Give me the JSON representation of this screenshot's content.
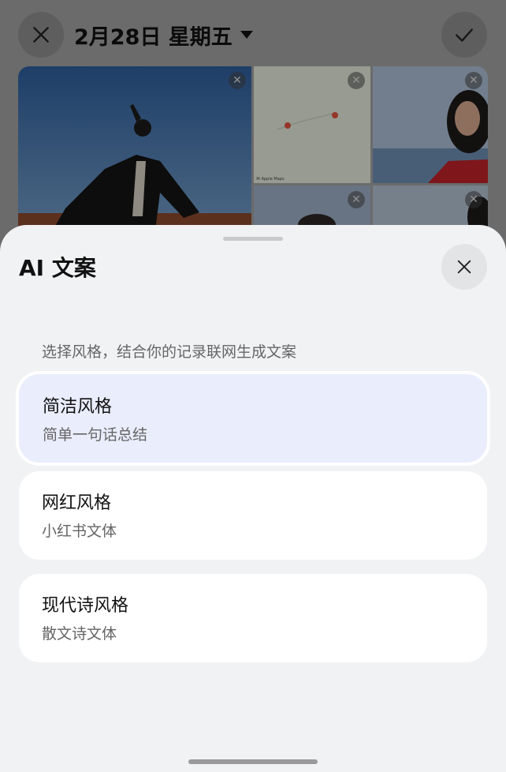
{
  "header": {
    "date": "2月28日 星期五"
  },
  "photos": {
    "map_caption": "⌘ Apple Maps"
  },
  "sheet": {
    "title": "AI 文案",
    "subtitle": "选择风格，结合你的记录联网生成文案",
    "options": [
      {
        "title": "简洁风格",
        "desc": "简单一句话总结",
        "selected": true
      },
      {
        "title": "网红风格",
        "desc": "小红书文体",
        "selected": false
      },
      {
        "title": "现代诗风格",
        "desc": "散文诗文体",
        "selected": false
      }
    ]
  },
  "icons": {
    "close": "close-icon",
    "confirm": "check-icon",
    "dropdown": "caret-down-icon",
    "remove": "remove-x-icon"
  },
  "colors": {
    "selected_option_bg": "#e9edfc",
    "sheet_bg": "#f1f2f4"
  }
}
